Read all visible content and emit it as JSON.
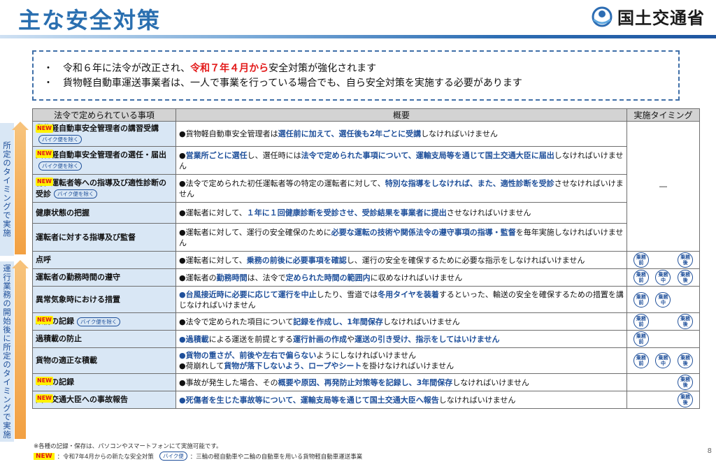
{
  "header": {
    "title": "主な安全対策",
    "ministry": "国土交通省"
  },
  "summary": {
    "bullet": "・",
    "line1_pre": "令和６年に法令が改正され、",
    "line1_red": "令和７年４月から",
    "line1_post": "安全対策が強化されます",
    "line2": "貨物軽自動車運送事業者は、一人で事業を行っている場合でも、自ら安全対策を実施する必要があります"
  },
  "bands": {
    "top": "所定のタイミングで実施",
    "bottom": "運行業務の開始後に所定のタイミングで実施"
  },
  "table": {
    "headers": [
      "法令で定められている事項",
      "概要",
      "実施タイミング"
    ],
    "new_label": "NEW",
    "bike_label": "バイク便を除く",
    "dash": "―",
    "rows": [
      {
        "item": "貨物軽自動車安全管理者の講習受講",
        "is_new": true,
        "bike": true,
        "desc": [
          [
            "n",
            "●貨物軽自動車安全管理者は"
          ],
          [
            "b",
            "選任前に加えて、選任後も2年ごとに受講"
          ],
          [
            "n",
            "しなければいけません"
          ]
        ]
      },
      {
        "item": "貨物軽自動車安全管理者の選任・届出",
        "is_new": true,
        "bike": true,
        "desc": [
          [
            "n",
            "●"
          ],
          [
            "b",
            "営業所ごとに選任"
          ],
          [
            "n",
            "し、選任時には"
          ],
          [
            "b",
            "法令で定められた事項について、運輸支局等を通じて国土交通大臣に届出"
          ],
          [
            "n",
            "しなければいけません"
          ]
        ]
      },
      {
        "item": "初任運転者等への指導及び適性診断の受診",
        "is_new": true,
        "bike": true,
        "desc": [
          [
            "n",
            "●法令で定められた初任運転者等の特定の運転者に対して、"
          ],
          [
            "b",
            "特別な指導をしなければ、また、適性診断を受診"
          ],
          [
            "n",
            "させなければいけません"
          ]
        ]
      },
      {
        "item": "健康状態の把握",
        "is_new": false,
        "bike": false,
        "desc": [
          [
            "n",
            "●運転者に対して、"
          ],
          [
            "b",
            "１年に１回健康診断を受診させ、受診結果を事業者に提出"
          ],
          [
            "n",
            "させなければいけません"
          ]
        ]
      },
      {
        "item": "運転者に対する指導及び監督",
        "is_new": false,
        "bike": false,
        "desc": [
          [
            "n",
            "●運転者に対して、運行の安全確保のために"
          ],
          [
            "b",
            "必要な運転の技術や関係法令の遵守事項の指導・監督"
          ],
          [
            "n",
            "を毎年実施しなければいけません"
          ]
        ]
      },
      {
        "item": "点呼",
        "is_new": false,
        "bike": false,
        "desc": [
          [
            "n",
            "●運転者に対して、"
          ],
          [
            "b",
            "乗務の前後に必要事項を確認"
          ],
          [
            "n",
            "し、運行の安全を確保するために必要な指示をしなければいけません"
          ]
        ],
        "badges": [
          "前",
          "",
          "後"
        ]
      },
      {
        "item": "運転者の勤務時間の遵守",
        "is_new": false,
        "bike": false,
        "desc": [
          [
            "n",
            "●運転者の"
          ],
          [
            "b",
            "勤務時間"
          ],
          [
            "n",
            "は、法令で"
          ],
          [
            "b",
            "定められた時間の範囲内"
          ],
          [
            "n",
            "に収めなければいけません"
          ]
        ],
        "badges": [
          "前",
          "中",
          "後"
        ]
      },
      {
        "item": "異常気象時における措置",
        "is_new": false,
        "bike": false,
        "desc": [
          [
            "b",
            "●台風接近時に必要に応じて運行を中止"
          ],
          [
            "n",
            "したり、雪道では"
          ],
          [
            "b",
            "冬用タイヤを装着"
          ],
          [
            "n",
            "するといった、輸送の安全を確保するための措置を講じなければいけません"
          ]
        ],
        "badges": [
          "前",
          "中",
          ""
        ]
      },
      {
        "item": "業務の記録",
        "is_new": true,
        "bike": true,
        "desc": [
          [
            "n",
            "●法令で定められた項目について"
          ],
          [
            "b",
            "記録を作成し、1年間保存"
          ],
          [
            "n",
            "しなければいけません"
          ]
        ],
        "badges": [
          "前",
          "",
          "後"
        ]
      },
      {
        "item": "過積載の防止",
        "is_new": false,
        "bike": false,
        "desc": [
          [
            "b",
            "●過積載"
          ],
          [
            "n",
            "による運送を前提とする"
          ],
          [
            "b",
            "運行計画の作成"
          ],
          [
            "n",
            "や"
          ],
          [
            "b",
            "運送の引き受け、指示をしてはいけません"
          ]
        ],
        "badges": [
          "前",
          "",
          ""
        ]
      },
      {
        "item": "貨物の適正な積載",
        "is_new": false,
        "bike": false,
        "desc": [
          [
            "b",
            "●貨物の重さが、前後や左右で偏らない"
          ],
          [
            "n",
            "ようにしなければいけません"
          ],
          [
            "br",
            ""
          ],
          [
            "n",
            "●荷崩れして"
          ],
          [
            "b",
            "貨物が落下しないよう、ロープやシート"
          ],
          [
            "n",
            "を掛けなければいけません"
          ]
        ],
        "badges": [
          "前",
          "中",
          "後"
        ]
      },
      {
        "item": "事故の記録",
        "is_new": true,
        "bike": false,
        "desc": [
          [
            "n",
            "●事故が発生した場合、その"
          ],
          [
            "b",
            "概要や原因、再発防止対策等を記録し、3年間保存"
          ],
          [
            "n",
            "しなければいけません"
          ]
        ],
        "badges": [
          "",
          "",
          "後"
        ]
      },
      {
        "item": "国土交通大臣への事故報告",
        "is_new": true,
        "bike": false,
        "desc": [
          [
            "b",
            "●死傷者を生じた事故等について、運輸支局等を通じて国土交通大臣へ報告"
          ],
          [
            "n",
            "しなければいけません"
          ]
        ],
        "badges": [
          "",
          "",
          "後"
        ]
      }
    ],
    "badge_top": "乗務"
  },
  "footnotes": {
    "note1": "※各種の記録・保存は、パソコンやスマートフォンにて実施可能です。",
    "note2_new": "NEW",
    "note2_new_text": "：令和7年4月からの新たな安全対策",
    "note2_bike": "バイク便",
    "note2_bike_text": "：三輪の軽自動車や二輪の自動車を用いる貨物軽自動車運送事業"
  },
  "page_number": "8",
  "colors": {
    "title_blue": "#2a6fb0",
    "accent_red": "#e31a1a",
    "text_blue": "#1e4f9a",
    "item_bg": "#d9e7f5",
    "header_bg": "#d3d3d3",
    "arrow_orange": "#f2a042"
  }
}
